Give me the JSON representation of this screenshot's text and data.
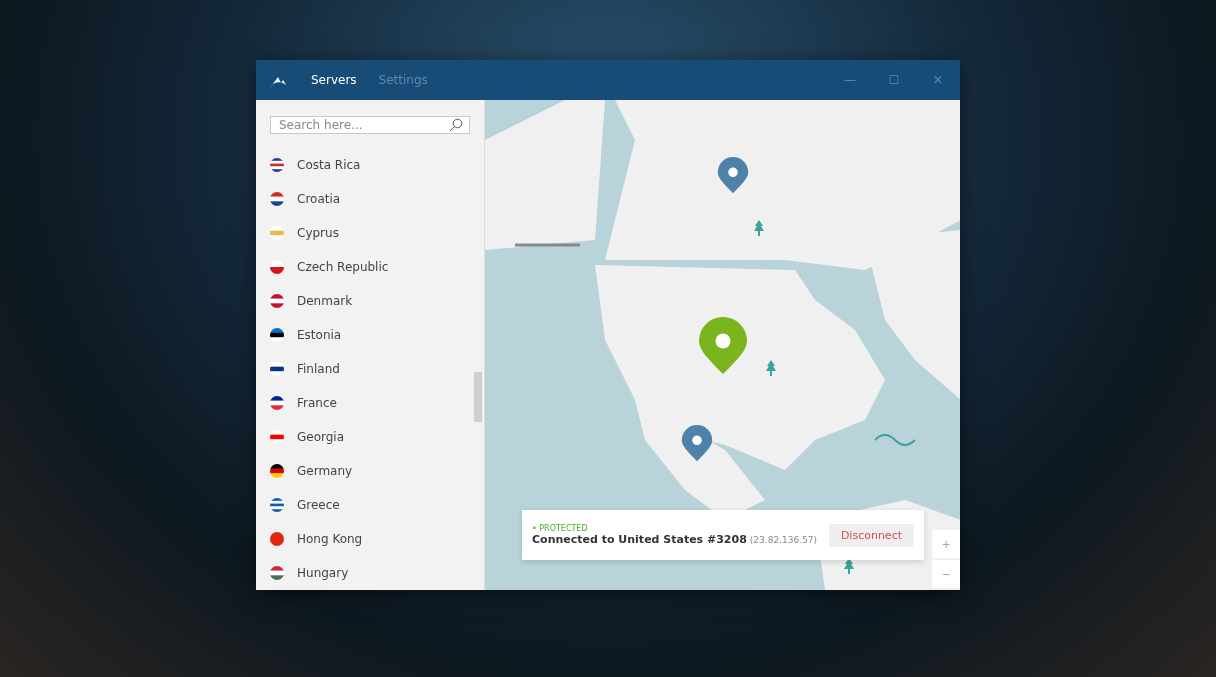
{
  "window": {
    "tabs": [
      {
        "label": "Servers",
        "selected": true
      },
      {
        "label": "Settings",
        "selected": false
      }
    ],
    "controls": [
      "—",
      "☐",
      "✕"
    ]
  },
  "search": {
    "placeholder": "Search here..."
  },
  "countries": [
    {
      "name": "Costa Rica"
    },
    {
      "name": "Croatia"
    },
    {
      "name": "Cyprus"
    },
    {
      "name": "Czech Republic"
    },
    {
      "name": "Denmark"
    },
    {
      "name": "Estonia"
    },
    {
      "name": "Finland"
    },
    {
      "name": "France"
    },
    {
      "name": "Georgia"
    },
    {
      "name": "Germany"
    },
    {
      "name": "Greece"
    },
    {
      "name": "Hong Kong"
    },
    {
      "name": "Hungary"
    }
  ],
  "status": {
    "label": "• PROTECTED",
    "message": "Connected to United States #3208",
    "ip": "(23.82.136.57)",
    "button": "Disconnect"
  },
  "zoom": [
    "+",
    "−"
  ]
}
